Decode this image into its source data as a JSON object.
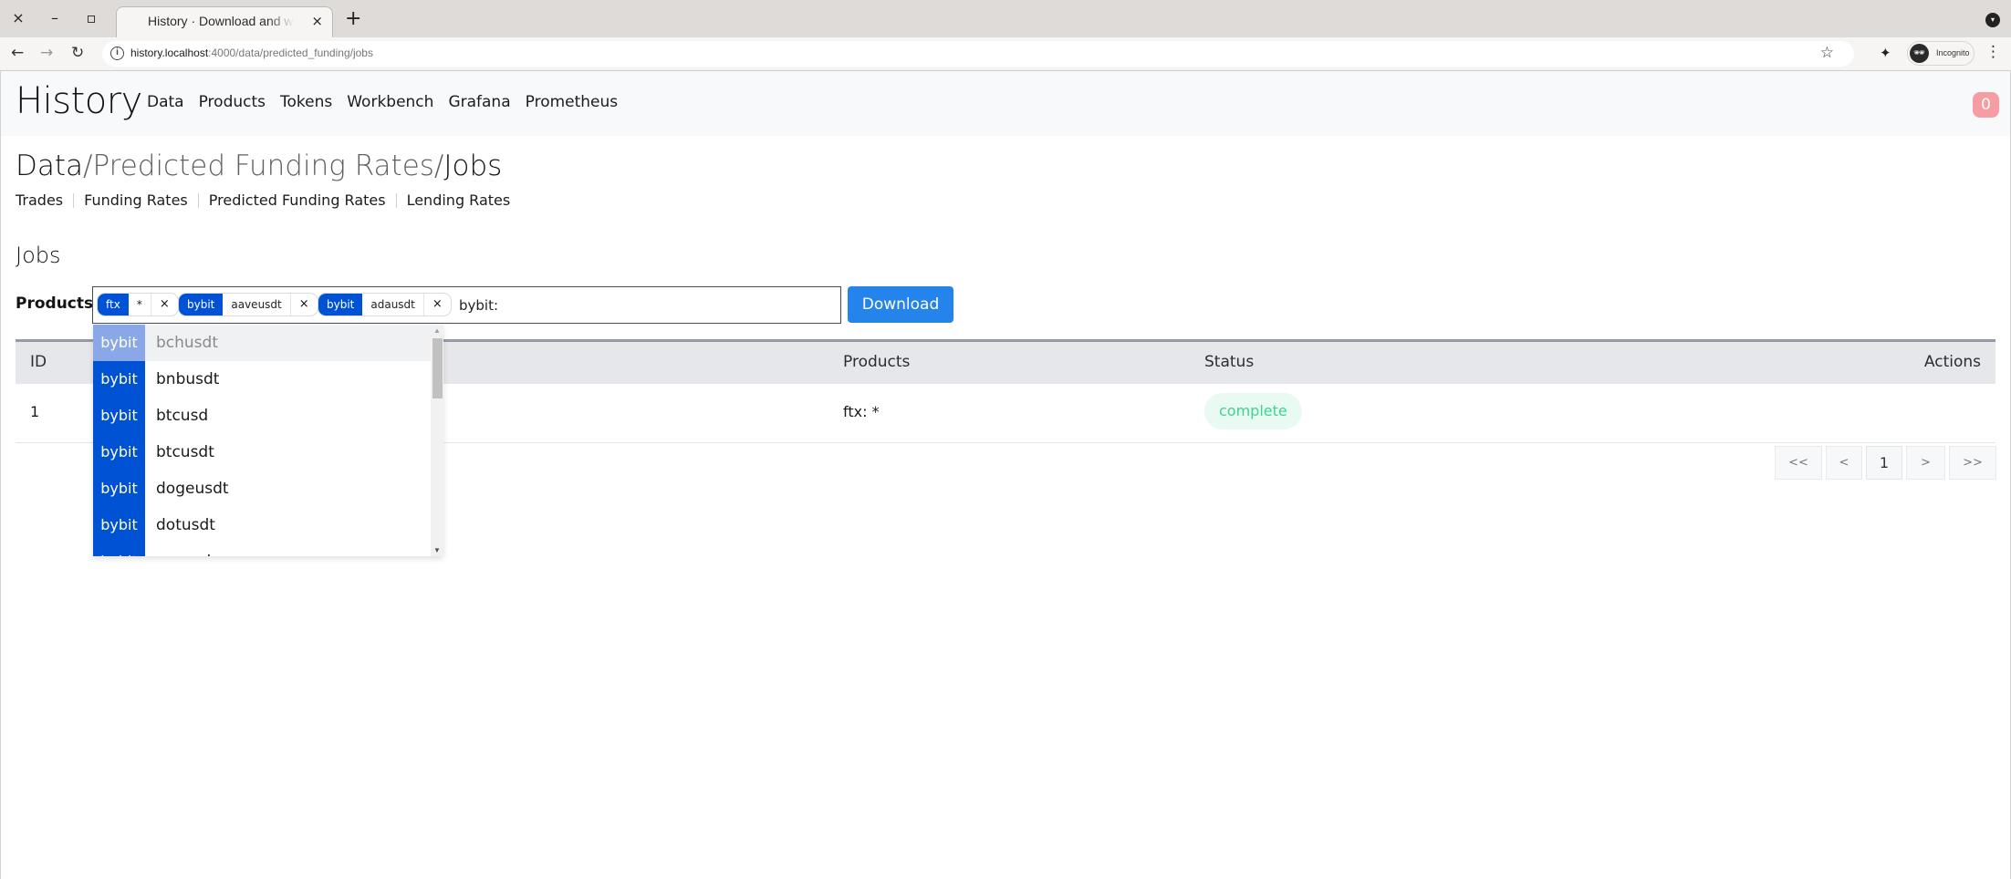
{
  "browser": {
    "window_controls": {
      "close": "×",
      "minimize": "–",
      "maximize": "▫"
    },
    "tab": {
      "title": "History · Download and watch",
      "close": "×"
    },
    "new_tab": "+",
    "tab_menu": "▾",
    "nav": {
      "back": "←",
      "forward": "→",
      "reload": "↻"
    },
    "url_host": "history.localhost",
    "url_path": ":4000/data/predicted_funding/jobs",
    "bookmark_icon": "☆",
    "extensions_icon": "✦",
    "profile_label": "Incognito",
    "menu_icon": "⋮"
  },
  "navbar": {
    "brand": "History",
    "items": [
      {
        "label": "Data"
      },
      {
        "label": "Products"
      },
      {
        "label": "Tokens"
      },
      {
        "label": "Workbench"
      },
      {
        "label": "Grafana"
      },
      {
        "label": "Prometheus"
      }
    ],
    "notification_count": "0"
  },
  "breadcrumb": {
    "root": "Data",
    "sep1": "/",
    "middle": "Predicted Funding Rates",
    "sep2": "/",
    "current": "Jobs"
  },
  "subnav": {
    "items": [
      {
        "label": "Trades"
      },
      {
        "label": "Funding Rates"
      },
      {
        "label": "Predicted Funding Rates"
      },
      {
        "label": "Lending Rates"
      }
    ]
  },
  "section": {
    "title": "Jobs"
  },
  "form": {
    "products_label": "Products:",
    "selected_products": [
      {
        "venue": "ftx",
        "symbol": "*",
        "remove": "×"
      },
      {
        "venue": "bybit",
        "symbol": "aaveusdt",
        "remove": "×"
      },
      {
        "venue": "bybit",
        "symbol": "adausdt",
        "remove": "×"
      }
    ],
    "query": "bybit:",
    "download_label": "Download"
  },
  "autocomplete": {
    "options": [
      {
        "venue": "bybit",
        "symbol": "bchusdt",
        "active": true
      },
      {
        "venue": "bybit",
        "symbol": "bnbusdt"
      },
      {
        "venue": "bybit",
        "symbol": "btcusd"
      },
      {
        "venue": "bybit",
        "symbol": "btcusdt"
      },
      {
        "venue": "bybit",
        "symbol": "dogeusdt"
      },
      {
        "venue": "bybit",
        "symbol": "dotusdt"
      },
      {
        "venue": "bybit",
        "symbol": "eosusd"
      }
    ],
    "scroll_up": "▲",
    "scroll_down": "▼"
  },
  "table": {
    "columns": [
      "ID",
      "Products",
      "Status",
      "Actions"
    ],
    "rows": [
      {
        "id": "1",
        "products": "ftx: *",
        "status": "complete"
      }
    ]
  },
  "pagination": {
    "first": "<<",
    "prev": "<",
    "current": "1",
    "next": ">",
    "last": ">>"
  },
  "colors": {
    "venue_chip": "#0052d4",
    "primary_button": "#2583ec",
    "status_complete_text": "#3cd494",
    "status_complete_bg": "#e8faf1",
    "notification_badge": "#f59da2"
  }
}
